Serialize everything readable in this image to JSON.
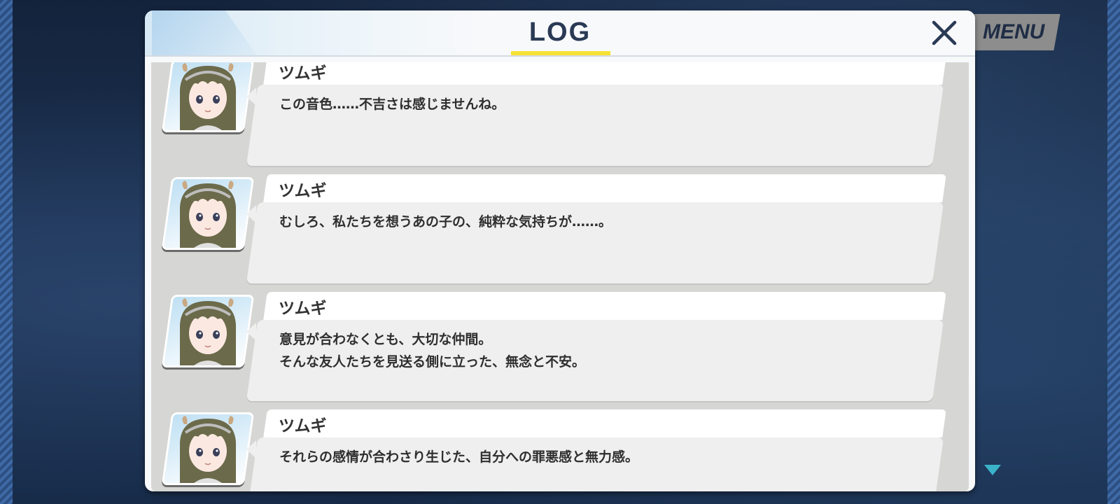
{
  "window": {
    "title": "LOG"
  },
  "menu": {
    "label": "MENU"
  },
  "entries": [
    {
      "speaker": "ツムギ",
      "lines": [
        "この音色……不吉さは感じませんね。"
      ]
    },
    {
      "speaker": "ツムギ",
      "lines": [
        "むしろ、私たちを想うあの子の、純粋な気持ちが……。"
      ]
    },
    {
      "speaker": "ツムギ",
      "lines": [
        "意見が合わなくとも、大切な仲間。",
        "そんな友人たちを見送る側に立った、無念と不安。"
      ]
    },
    {
      "speaker": "ツムギ",
      "lines": [
        "それらの感情が合わさり生じた、自分への罪悪感と無力感。"
      ]
    }
  ],
  "icons": {
    "close": "close-icon",
    "scroll": "down-arrow-icon",
    "portrait": "character-portrait"
  },
  "colors": {
    "title_underline": "#f5e234",
    "title_text": "#2a3a55",
    "scroll_arrow": "#3ab3c9"
  }
}
